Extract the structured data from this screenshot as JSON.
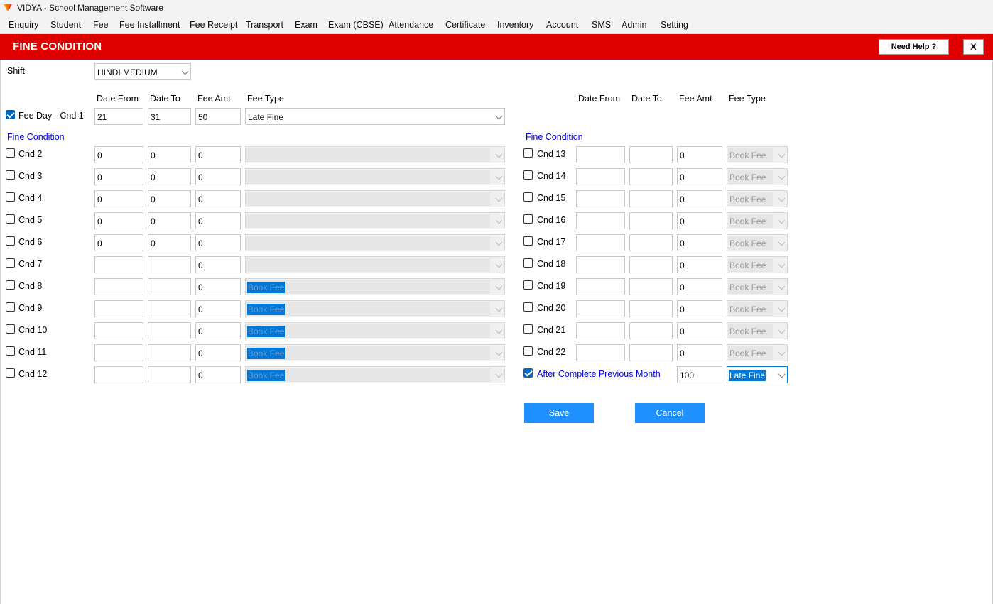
{
  "window": {
    "title": "VIDYA - School Management Software"
  },
  "menu": [
    "Enquiry",
    "Student",
    "Fee",
    "Fee Installment",
    "Fee Receipt",
    "Transport",
    "Exam",
    "Exam (CBSE)",
    "Attendance",
    "Certificate",
    "Inventory",
    "Account",
    "SMS",
    "Admin",
    "Setting"
  ],
  "header": {
    "title": "FINE CONDITION",
    "help_label": "Need Help ?",
    "close_label": "X"
  },
  "shift": {
    "label": "Shift",
    "value": "HINDI MEDIUM"
  },
  "columns": {
    "date_from": "Date From",
    "date_to": "Date To",
    "fee_amt": "Fee Amt",
    "fee_type": "Fee Type"
  },
  "section_label": "Fine Condition",
  "left": {
    "main": {
      "label": "Fee Day - Cnd 1",
      "checked": true,
      "date_from": "21",
      "date_to": "31",
      "fee_amt": "50",
      "fee_type": "Late Fine"
    },
    "rows": [
      {
        "label": "Cnd 2",
        "date_from": "0",
        "date_to": "0",
        "fee_amt": "0",
        "fee_type": ""
      },
      {
        "label": "Cnd 3",
        "date_from": "0",
        "date_to": "0",
        "fee_amt": "0",
        "fee_type": ""
      },
      {
        "label": "Cnd 4",
        "date_from": "0",
        "date_to": "0",
        "fee_amt": "0",
        "fee_type": ""
      },
      {
        "label": "Cnd 5",
        "date_from": "0",
        "date_to": "0",
        "fee_amt": "0",
        "fee_type": ""
      },
      {
        "label": "Cnd 6",
        "date_from": "0",
        "date_to": "0",
        "fee_amt": "0",
        "fee_type": ""
      },
      {
        "label": "Cnd 7",
        "date_from": "",
        "date_to": "",
        "fee_amt": "0",
        "fee_type": ""
      },
      {
        "label": "Cnd 8",
        "date_from": "",
        "date_to": "",
        "fee_amt": "0",
        "fee_type": "Book Fee"
      },
      {
        "label": "Cnd 9",
        "date_from": "",
        "date_to": "",
        "fee_amt": "0",
        "fee_type": "Book Fee"
      },
      {
        "label": "Cnd 10",
        "date_from": "",
        "date_to": "",
        "fee_amt": "0",
        "fee_type": "Book Fee"
      },
      {
        "label": "Cnd 11",
        "date_from": "",
        "date_to": "",
        "fee_amt": "0",
        "fee_type": "Book Fee"
      },
      {
        "label": "Cnd 12",
        "date_from": "",
        "date_to": "",
        "fee_amt": "0",
        "fee_type": "Book Fee"
      }
    ]
  },
  "right": {
    "rows": [
      {
        "label": "Cnd 13",
        "date_from": "",
        "date_to": "",
        "fee_amt": "0",
        "fee_type": "Book Fee"
      },
      {
        "label": "Cnd 14",
        "date_from": "",
        "date_to": "",
        "fee_amt": "0",
        "fee_type": "Book Fee"
      },
      {
        "label": "Cnd 15",
        "date_from": "",
        "date_to": "",
        "fee_amt": "0",
        "fee_type": "Book Fee"
      },
      {
        "label": "Cnd 16",
        "date_from": "",
        "date_to": "",
        "fee_amt": "0",
        "fee_type": "Book Fee"
      },
      {
        "label": "Cnd 17",
        "date_from": "",
        "date_to": "",
        "fee_amt": "0",
        "fee_type": "Book Fee"
      },
      {
        "label": "Cnd 18",
        "date_from": "",
        "date_to": "",
        "fee_amt": "0",
        "fee_type": "Book Fee"
      },
      {
        "label": "Cnd 19",
        "date_from": "",
        "date_to": "",
        "fee_amt": "0",
        "fee_type": "Book Fee"
      },
      {
        "label": "Cnd 20",
        "date_from": "",
        "date_to": "",
        "fee_amt": "0",
        "fee_type": "Book Fee"
      },
      {
        "label": "Cnd 21",
        "date_from": "",
        "date_to": "",
        "fee_amt": "0",
        "fee_type": "Book Fee"
      },
      {
        "label": "Cnd 22",
        "date_from": "",
        "date_to": "",
        "fee_amt": "0",
        "fee_type": "Book Fee"
      }
    ],
    "after_month": {
      "label": "After Complete Previous Month",
      "checked": true,
      "fee_amt": "100",
      "fee_type": "Late Fine"
    }
  },
  "buttons": {
    "save": "Save",
    "cancel": "Cancel"
  },
  "colors": {
    "header": "#e00000",
    "button": "#1e90ff",
    "link_blue": "#0000e0",
    "selection": "#0078d7"
  }
}
